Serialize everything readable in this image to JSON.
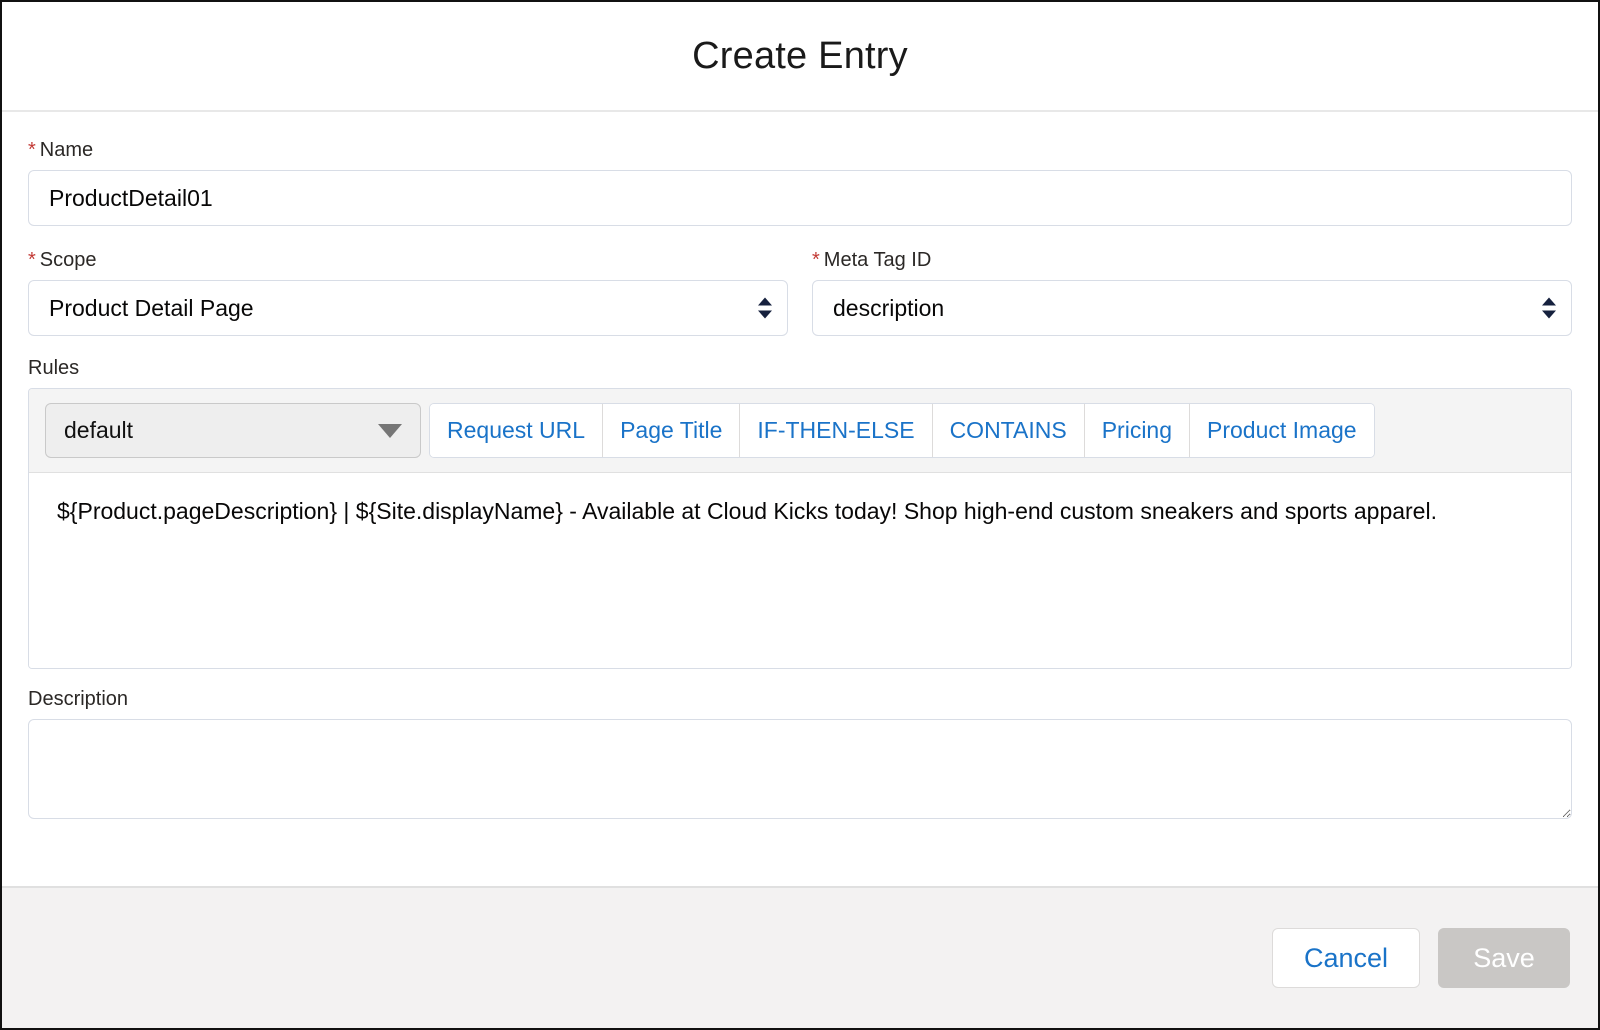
{
  "dialog": {
    "title": "Create Entry"
  },
  "form": {
    "name_field": {
      "label": "Name",
      "required_marker": "*",
      "value": "ProductDetail01",
      "placeholder": ""
    },
    "scope_field": {
      "label": "Scope",
      "required_marker": "*",
      "value": "Product Detail Page"
    },
    "meta_tag_id_field": {
      "label": "Meta Tag ID",
      "required_marker": "*",
      "value": "description"
    },
    "rules": {
      "label": "Rules",
      "selected_rule": "default",
      "toolbar_buttons": [
        {
          "label": "Request URL"
        },
        {
          "label": "Page Title"
        },
        {
          "label": "IF-THEN-ELSE"
        },
        {
          "label": "CONTAINS"
        },
        {
          "label": "Pricing"
        },
        {
          "label": "Product Image"
        }
      ],
      "content": "${Product.pageDescription} | ${Site.displayName} - Available at Cloud Kicks today! Shop high-end custom sneakers and sports apparel."
    },
    "description_field": {
      "label": "Description",
      "value": "",
      "placeholder": ""
    }
  },
  "footer": {
    "cancel_label": "Cancel",
    "save_label": "Save"
  },
  "colors": {
    "link_blue": "#1a73c8",
    "required_red": "#c23934",
    "footer_bg": "#f3f2f2",
    "toolbar_bg": "#f4f4f4",
    "disabled_gray": "#c9c7c5"
  }
}
